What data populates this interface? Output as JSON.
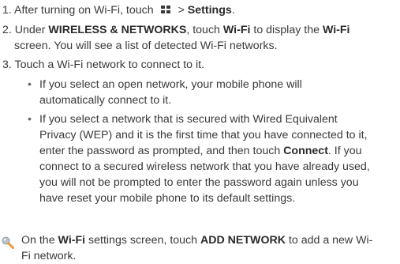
{
  "step1": {
    "prefix": "1. After turning on Wi-Fi, touch",
    "menu_arrow": " > ",
    "settings": "Settings",
    "suffix": "."
  },
  "step2": {
    "prefix": "2. Under ",
    "wireless_networks": "WIRELESS & NETWORKS",
    "mid": ", touch ",
    "wifi": "Wi-Fi",
    "mid2": " to display the ",
    "wifi2": "Wi-Fi",
    "line2": "screen. You will see a list of detected Wi-Fi networks."
  },
  "step3": {
    "text": "3. Touch a Wi-Fi network to connect to it."
  },
  "bullet1": {
    "line1": "If you select an open network, your mobile phone will",
    "line2": "automatically connect to it."
  },
  "bullet2": {
    "line1": "If you select a network that is secured with Wired Equivalent",
    "line2": "Privacy (WEP) and it is the first time that you have connected to it,",
    "line3_prefix": "enter the password as prompted, and then touch ",
    "connect": "Connect",
    "line3_suffix": ". If you",
    "line4": "connect to a secured wireless network that you have already used,",
    "line5": "you will not be prompted to enter the password again unless you",
    "line6": "have reset your mobile phone to its default settings."
  },
  "tip": {
    "icon": "tip-icon",
    "prefix": "On the ",
    "wifi": "Wi-Fi",
    "mid": " settings screen, touch ",
    "add_network": "ADD NETWORK",
    "suffix": " to add a new Wi-",
    "line2": "Fi network."
  },
  "colors": {
    "text": "#3a3a3a",
    "bold_text": "#2a2a2a",
    "icon": "#3a3a3a"
  }
}
